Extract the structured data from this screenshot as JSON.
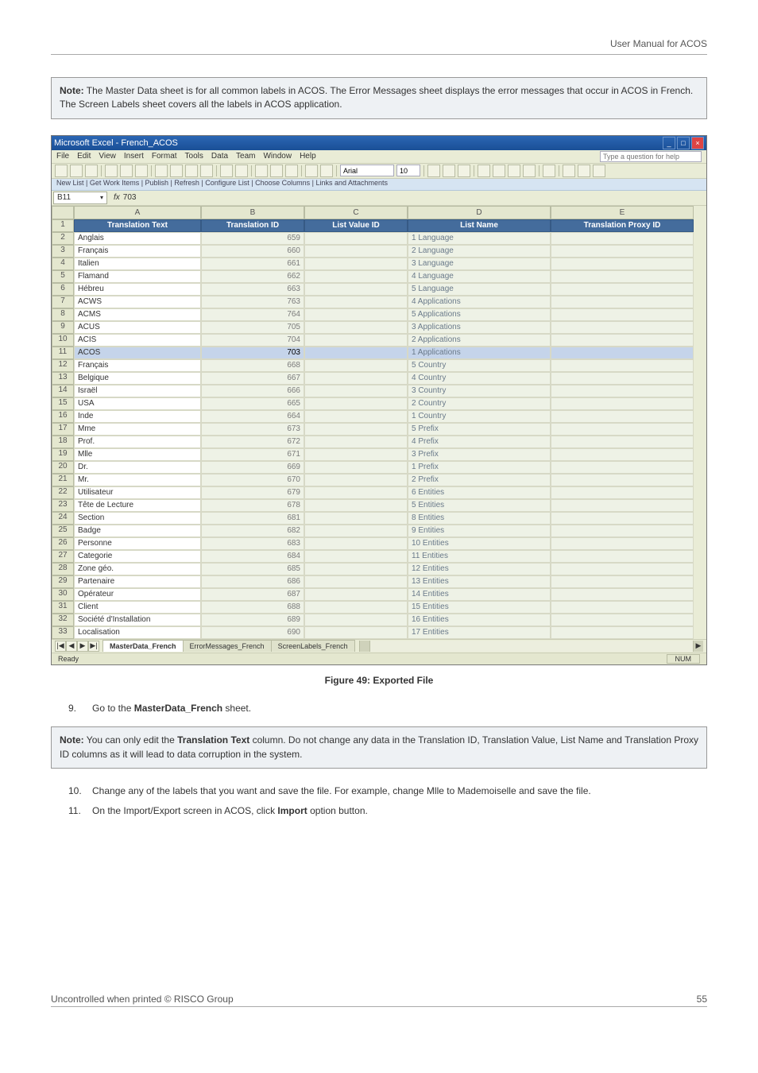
{
  "header_right": "User Manual for ACOS",
  "note1_label": "Note:",
  "note1_text": " The Master Data sheet is for all common labels in ACOS. The Error Messages sheet displays the error messages that occur in ACOS in French. The Screen Labels sheet covers all the labels in ACOS application.",
  "figure_caption": "Figure 49: Exported File",
  "step9_num": "9.",
  "step9_pre": "Go to the ",
  "step9_bold": "MasterData_French",
  "step9_post": " sheet.",
  "note2_label": "Note:",
  "note2_pre": " You can only edit the ",
  "note2_bold": "Translation Text",
  "note2_post": " column. Do not change any data in the Translation ID, Translation Value, List Name and Translation Proxy ID columns as it will lead to data corruption in the system.",
  "step10_num": "10.",
  "step10_text": "Change any of the labels that you want and save the file. For example, change Mlle to Mademoiselle and save the file.",
  "step11_num": "11.",
  "step11_pre": "On the Import/Export screen in ACOS, click ",
  "step11_bold": "Import",
  "step11_post": " option button.",
  "footer_left": "Uncontrolled when printed © RISCO Group",
  "footer_right": "55",
  "excel": {
    "title": "Microsoft Excel - French_ACOS",
    "questionbox": "Type a question for help",
    "menus": [
      "File",
      "Edit",
      "View",
      "Insert",
      "Format",
      "Tools",
      "Data",
      "Team",
      "Window",
      "Help"
    ],
    "font_name": "Arial",
    "font_size": "10",
    "listbar": "New List | Get Work Items | Publish | Refresh | Configure List | Choose Columns | Links and Attachments",
    "namebox": "B11",
    "fx_label": "fx",
    "fx_value": "703",
    "cols": [
      "",
      "A",
      "B",
      "C",
      "D",
      "E"
    ],
    "headrow": [
      "1",
      "Translation Text",
      "Translation ID",
      "List Value ID",
      "List Name",
      "Translation Proxy ID"
    ],
    "rows": [
      [
        "2",
        "Anglais",
        "659",
        "",
        "1 Language",
        ""
      ],
      [
        "3",
        "Français",
        "660",
        "",
        "2 Language",
        ""
      ],
      [
        "4",
        "Italien",
        "661",
        "",
        "3 Language",
        ""
      ],
      [
        "5",
        "Flamand",
        "662",
        "",
        "4 Language",
        ""
      ],
      [
        "6",
        "Hébreu",
        "663",
        "",
        "5 Language",
        ""
      ],
      [
        "7",
        "ACWS",
        "763",
        "",
        "4 Applications",
        ""
      ],
      [
        "8",
        "ACMS",
        "764",
        "",
        "5 Applications",
        ""
      ],
      [
        "9",
        "ACUS",
        "705",
        "",
        "3 Applications",
        ""
      ],
      [
        "10",
        "ACIS",
        "704",
        "",
        "2 Applications",
        ""
      ],
      [
        "11",
        "ACOS",
        "703",
        "",
        "1 Applications",
        ""
      ],
      [
        "12",
        "Français",
        "668",
        "",
        "5 Country",
        ""
      ],
      [
        "13",
        "Belgique",
        "667",
        "",
        "4 Country",
        ""
      ],
      [
        "14",
        "Israël",
        "666",
        "",
        "3 Country",
        ""
      ],
      [
        "15",
        "USA",
        "665",
        "",
        "2 Country",
        ""
      ],
      [
        "16",
        "Inde",
        "664",
        "",
        "1 Country",
        ""
      ],
      [
        "17",
        "Mme",
        "673",
        "",
        "5 Prefix",
        ""
      ],
      [
        "18",
        "Prof.",
        "672",
        "",
        "4 Prefix",
        ""
      ],
      [
        "19",
        "Mlle",
        "671",
        "",
        "3 Prefix",
        ""
      ],
      [
        "20",
        "Dr.",
        "669",
        "",
        "1 Prefix",
        ""
      ],
      [
        "21",
        "Mr.",
        "670",
        "",
        "2 Prefix",
        ""
      ],
      [
        "22",
        "Utilisateur",
        "679",
        "",
        "6 Entities",
        ""
      ],
      [
        "23",
        "Tête de Lecture",
        "678",
        "",
        "5 Entities",
        ""
      ],
      [
        "24",
        "Section",
        "681",
        "",
        "8 Entities",
        ""
      ],
      [
        "25",
        "Badge",
        "682",
        "",
        "9 Entities",
        ""
      ],
      [
        "26",
        "Personne",
        "683",
        "",
        "10 Entities",
        ""
      ],
      [
        "27",
        "Categorie",
        "684",
        "",
        "11 Entities",
        ""
      ],
      [
        "28",
        "Zone géo.",
        "685",
        "",
        "12 Entities",
        ""
      ],
      [
        "29",
        "Partenaire",
        "686",
        "",
        "13 Entities",
        ""
      ],
      [
        "30",
        "Opérateur",
        "687",
        "",
        "14 Entities",
        ""
      ],
      [
        "31",
        "Client",
        "688",
        "",
        "15 Entities",
        ""
      ],
      [
        "32",
        "Société d'Installation",
        "689",
        "",
        "16 Entities",
        ""
      ],
      [
        "33",
        "Localisation",
        "690",
        "",
        "17 Entities",
        ""
      ]
    ],
    "tabs_nav": [
      "|◀",
      "◀",
      "▶",
      "▶|"
    ],
    "tab1": "MasterData_French",
    "tab2": "ErrorMessages_French",
    "tab3": "ScreenLabels_French",
    "status_left": "Ready",
    "status_num": "NUM"
  }
}
